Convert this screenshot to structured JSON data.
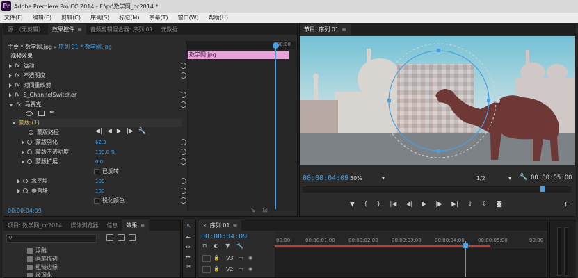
{
  "window": {
    "title": "Adobe Premiere Pro CC 2014 - F:\\pr\\数学网_cc2014 *",
    "app_icon": "Pr"
  },
  "menu": [
    "文件(F)",
    "编辑(E)",
    "剪辑(C)",
    "序列(S)",
    "标记(M)",
    "字幕(T)",
    "窗口(W)",
    "帮助(H)"
  ],
  "source_tabs": [
    {
      "label": "源：（无剪辑）"
    },
    {
      "label": "效果控件",
      "close": "≡"
    },
    {
      "label": "音频剪辑混合器: 序列 01"
    },
    {
      "label": "元数据"
    }
  ],
  "effect_controls": {
    "breadcrumb_main": "主要 * 数学网.jpg",
    "breadcrumb_seq": "序列 01 * 数学网.jpg",
    "clip_label": "数学网.jpg",
    "section": "视频效果",
    "effects": [
      "运动",
      "不透明度",
      "时间重映射",
      "S_ChannelSwitcher",
      "马赛克"
    ],
    "mask_label": "蒙版 (1)",
    "mask_path_label": "蒙版路径",
    "props": [
      {
        "name": "蒙版羽化",
        "value": "62.3"
      },
      {
        "name": "蒙版不透明度",
        "value": "100.0 %"
      },
      {
        "name": "蒙版扩展",
        "value": "0.0"
      }
    ],
    "inverted_label": "已反转",
    "horiz_label": "水平块",
    "horiz_value": "100",
    "vert_label": "垂直块",
    "vert_value": "100",
    "sharp_label": "锐化颜色",
    "timecode": "00:00:04:09",
    "timeline_ruler": "00:00"
  },
  "program": {
    "tab": "节目: 序列 01",
    "tab_close": "≡",
    "timecode": "00:00:04:09",
    "zoom": "50%",
    "resolution": "1/2",
    "duration": "00:00:05:00",
    "playhead_fraction": 0.9
  },
  "project": {
    "tabs": [
      "项目: 数学网_cc2014",
      "媒体浏览器",
      "信息",
      "效果"
    ],
    "tab_close": "≡",
    "items": [
      "浮雕",
      "画笔描边",
      "粗糙边缘",
      "纹理化"
    ]
  },
  "timeline": {
    "tab": "序列 01",
    "tab_close": "≡",
    "timecode": "00:00:04:09",
    "ruler": [
      "00:00",
      "00:00:01:00",
      "00:00:02:00",
      "00:00:03:00",
      "00:00:04:00",
      "00:00:05:00",
      "00:00"
    ],
    "tracks": [
      "V3",
      "V2"
    ]
  },
  "colors": {
    "accent": "#4a9fe0",
    "clip": "#e7a3d8",
    "panel": "#2b2b2b"
  }
}
